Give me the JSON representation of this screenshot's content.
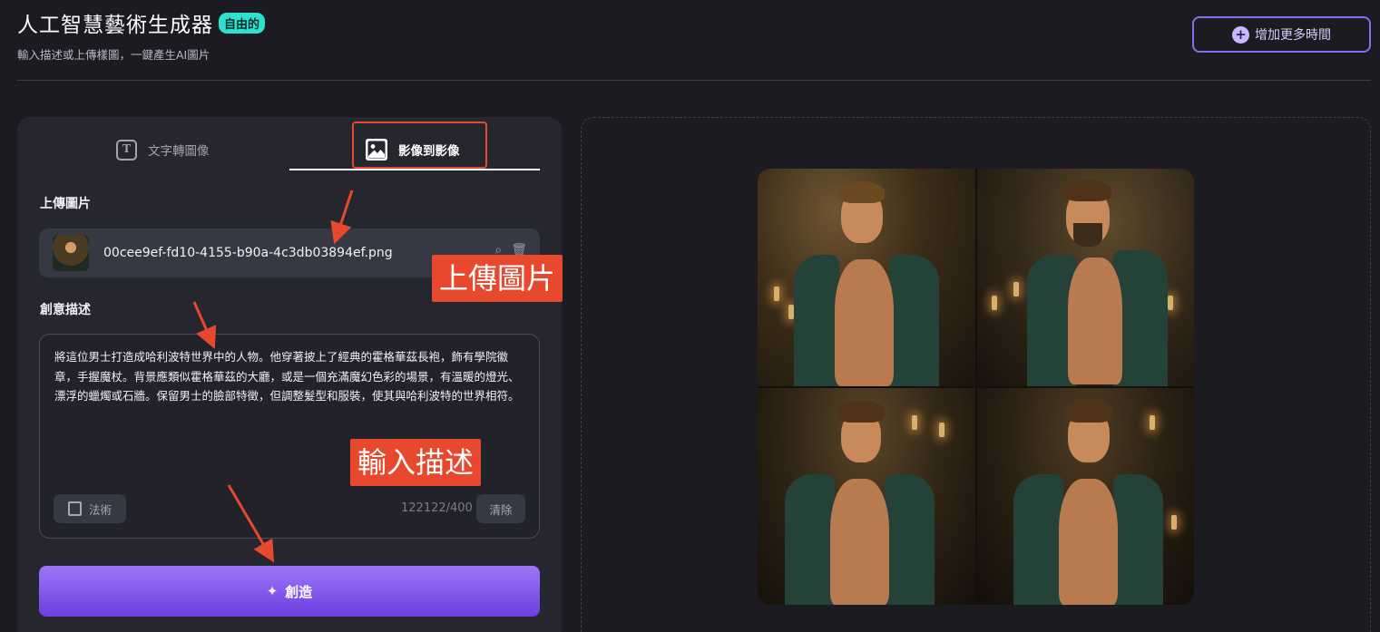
{
  "header": {
    "title": "人工智慧藝術生成器",
    "badge": "自由的",
    "subtitle": "輸入描述或上傳樣圖，一鍵產生AI圖片",
    "more_time_label": "增加更多時間",
    "more_time_icon": "plus-circle-icon"
  },
  "tabs": [
    {
      "label": "文字轉圖像",
      "icon": "text-icon",
      "active": false
    },
    {
      "label": "影像到影像",
      "icon": "image-icon",
      "active": true
    }
  ],
  "upload": {
    "label": "上傳圖片",
    "filename": "00cee9ef-fd10-4155-b90a-4c3db03894ef.png"
  },
  "description": {
    "label": "創意描述",
    "text": "將這位男士打造成哈利波特世界中的人物。他穿著披上了經典的霍格華茲長袍，飾有學院徽章，手握魔杖。背景應類似霍格華茲的大廳，或是一個充滿魔幻色彩的場景，有溫暖的燈光、漂浮的蠟燭或石牆。保留男士的臉部特徵，但調整髮型和服裝，使其與哈利波特的世界相符。",
    "style_button": "法術",
    "counter": "122122/400",
    "clear_button": "清除"
  },
  "create_button": "創造",
  "annotations": {
    "upload_callout": "上傳圖片",
    "describe_callout": "輸入描述"
  },
  "colors": {
    "accent": "#8b6cf0",
    "badge": "#2de0d0",
    "callout": "#e8482e",
    "create_gradient_top": "#9d76f8",
    "create_gradient_bottom": "#6b3fe0"
  }
}
